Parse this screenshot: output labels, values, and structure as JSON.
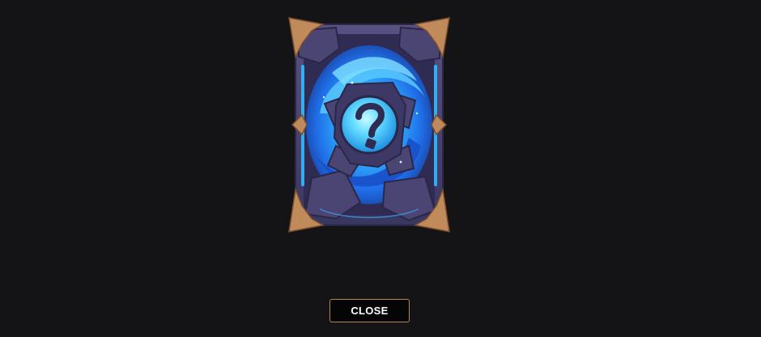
{
  "card": {
    "icon": "mystery-card-question-icon",
    "colors": {
      "frame": "#4a4572",
      "frame_dark": "#332f55",
      "swirl_light": "#33b8ff",
      "swirl_mid": "#1f6fe8",
      "orb": "#5fd8ff",
      "spikes": "#c08a5a",
      "spike_dark": "#7a4f30"
    }
  },
  "close_button": {
    "label": "CLOSE",
    "border_color": "#b08a52"
  },
  "background_color": "#141416"
}
